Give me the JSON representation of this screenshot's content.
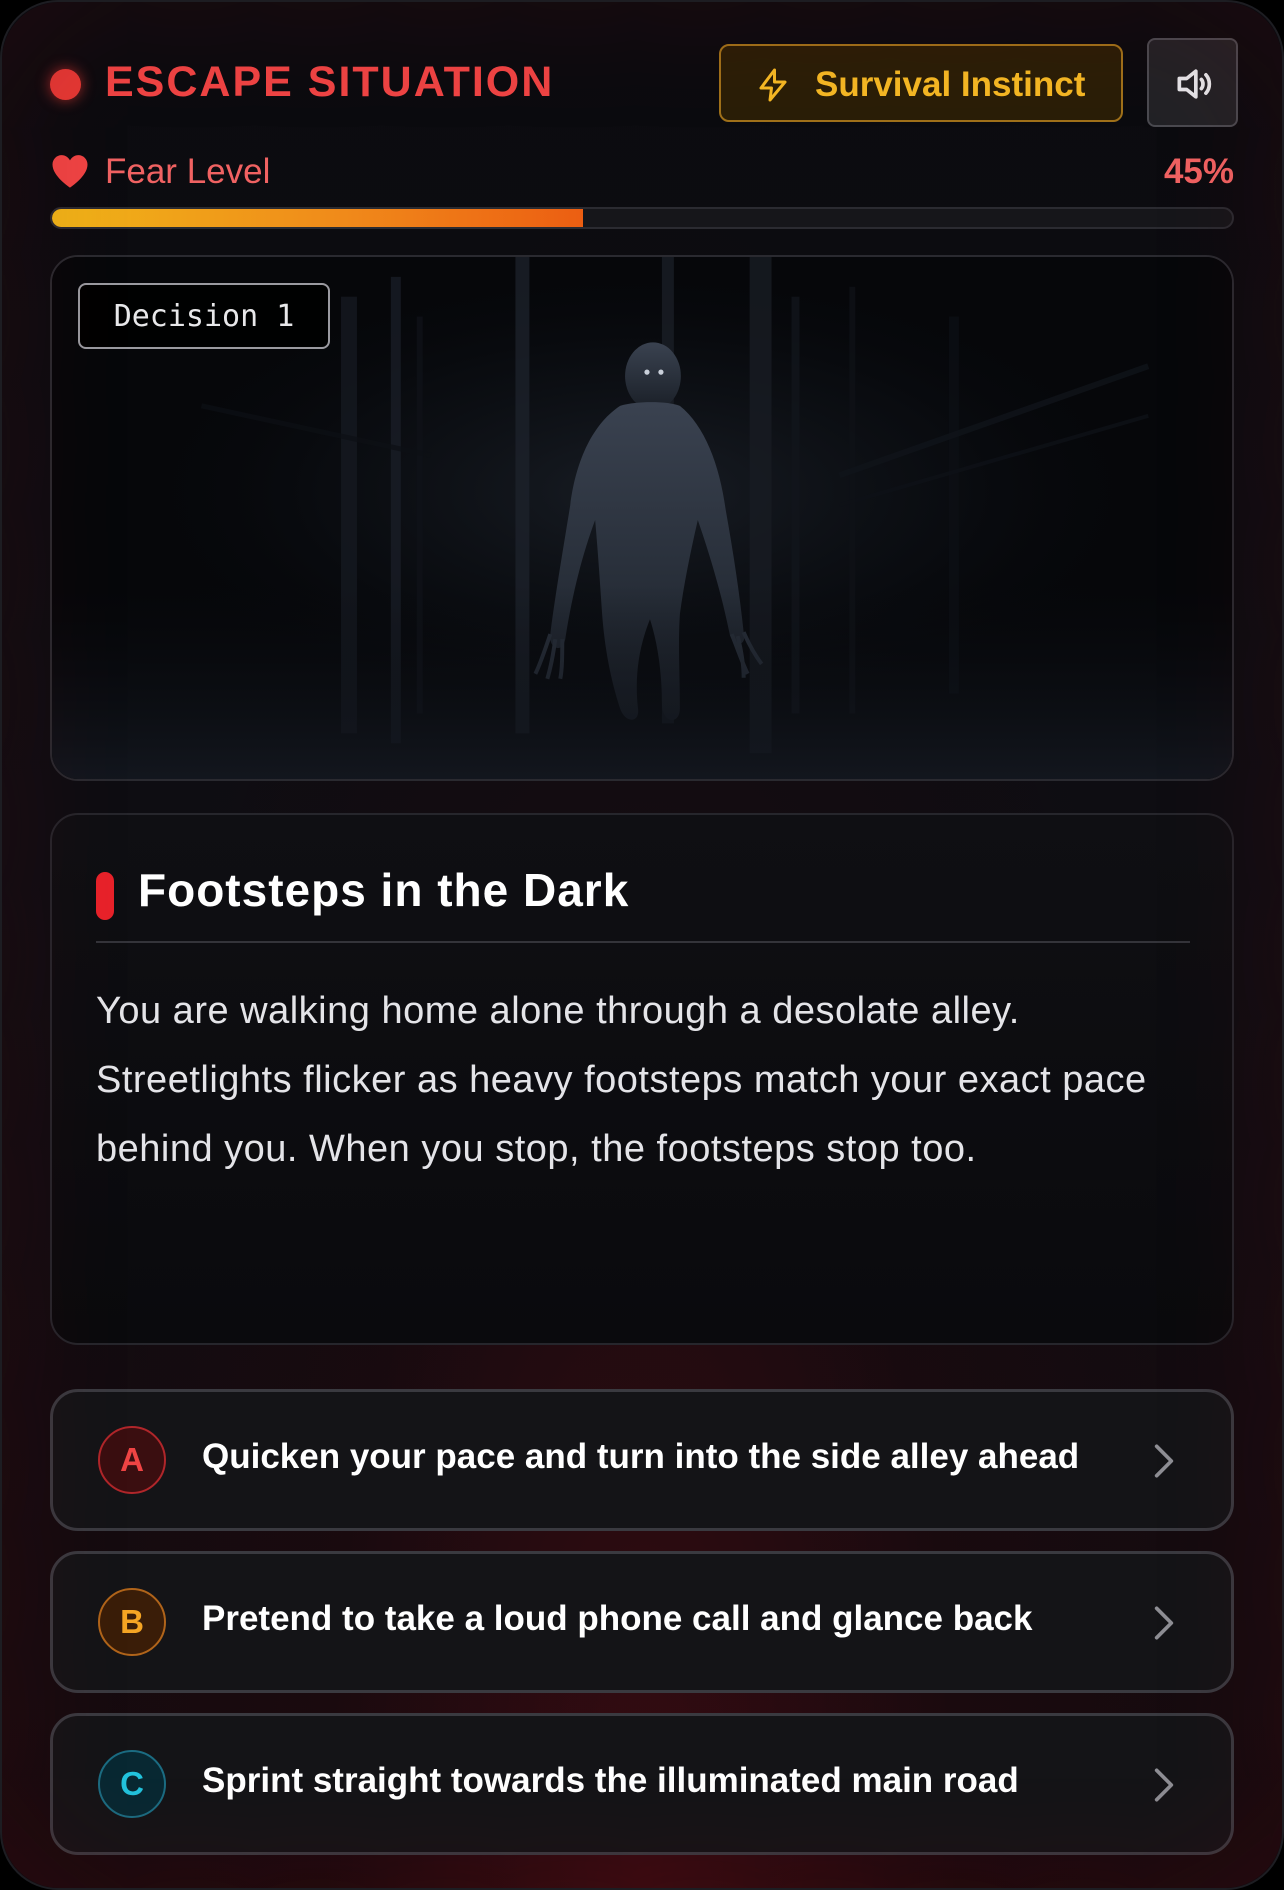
{
  "header": {
    "title": "ESCAPE SITUATION",
    "instinct_label": "Survival Instinct"
  },
  "fear": {
    "label": "Fear Level",
    "value_text": "45%",
    "value": 0.45
  },
  "scene": {
    "decision_label": "Decision 1"
  },
  "story": {
    "title": "Footsteps in the Dark",
    "text": "You are walking home alone through a desolate alley. Streetlights flicker as heavy footsteps match your exact pace behind you. When you stop, the footsteps stop too."
  },
  "choices": [
    {
      "letter": "A",
      "text": "Quicken your pace and turn into the side alley ahead"
    },
    {
      "letter": "B",
      "text": "Pretend to take a loud phone call and glance back"
    },
    {
      "letter": "C",
      "text": "Sprint straight towards the illuminated main road"
    }
  ],
  "colors": {
    "danger": "#ef4444",
    "instinct": "#f5b824",
    "choice_a": "#ef4444",
    "choice_b": "#f5a524",
    "choice_c": "#22c3dd"
  },
  "icons": {
    "status": "recording-dot-icon",
    "instinct": "lightning-bolt-icon",
    "sound": "speaker-volume-icon",
    "fear": "heart-icon",
    "choice_arrow": "chevron-right-icon"
  }
}
